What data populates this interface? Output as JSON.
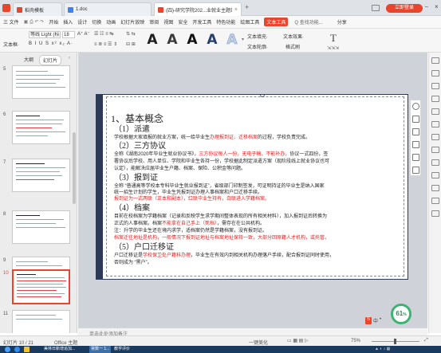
{
  "tabs": [
    {
      "label": "稻壳模板",
      "color": "#e8452c"
    },
    {
      "label": "1.doc",
      "color": "#3b82f6"
    },
    {
      "label": "(四)-研究学院202...业就业主题班会",
      "color": "#e8452c"
    }
  ],
  "login_button": "立即登录",
  "menu": {
    "file": "三 文件",
    "items": [
      "开始",
      "插入",
      "设计",
      "切换",
      "动画",
      "幻灯片放映",
      "审阅",
      "视图",
      "安全",
      "开发工具",
      "特色功能",
      "绘图工具",
      "文本工具"
    ],
    "active": "文本工具",
    "search": "Q 查找功能...",
    "share": "分享"
  },
  "toolbar": {
    "font": "等线 Light (标题)",
    "size": "18",
    "text_box": "文本框·",
    "text_fill": "文本填充·",
    "text_outline": "文本轮廓·",
    "text_effect": "文本效果·",
    "wordart_glyph": "A",
    "wordart_count": 5,
    "styles": [
      "#1f1f1f",
      "#3a3a3a",
      "#111111",
      "#27406b",
      "#bfcde5"
    ],
    "format_painter": "格式刷"
  },
  "left_panel": {
    "header": "大纲",
    "tab": "幻灯片",
    "slide_numbers": [
      "5",
      "6",
      "7",
      "8",
      "9",
      "10",
      "11"
    ],
    "selected": "10"
  },
  "slide": {
    "h1": "1、基本概念",
    "s1": "（1）派遣",
    "p1a": "学校根据大家填报的就业方案，统一给毕业生",
    "p1b": "办理报到证、迁移档案",
    "p1c": "的过程，学校负责完成。",
    "s2": "（2）三方协议",
    "p2a": "全称《湖南2020年毕业生就业协议书》，",
    "p2b": "三方协议每人一份，无电子稿，不能补办。",
    "p2c": "协议一式四份，签",
    "p2d": "署协议后学校、用人单位、学院和毕业生各持一份，学校据此制定派遣方案（现阶段线上就业协议也可",
    "p2e": "认定），能解决应届毕业生户籍、档案、保险、公积金等问题。",
    "s3": "（3）报到证",
    "p3a": "全称 “普通高等学校本专科毕业生就业报到证”，省级部门印制签发，可证明持证的毕业生是纳入国家",
    "p3b": "统一招生计划的学生，毕业生凭报到证办理人事档案和户口迁移手续。",
    "p3c": "报到证为一式两联（正本和副本），红联毕业生持有，白联进入学籍档案。",
    "s4": "（4）档案",
    "p4a": "目前在校档案为学籍档案（记录和反映学生求学期间整体表现的所有相关材料），加入报到证后转换为",
    "p4b": "正式的人事档案。档案",
    "p4c": "不能拿在自己手上（死档）",
    "p4d": "，需存在在公共机构。",
    "p4e": "注：升学的毕业生还在境内求学，适档案仍然是学籍档案，没有报到证。",
    "p4f": "档案迁往地址是机构，一般情况下报到证地址与档案地址保持一致，大部分回原籍人才机构，或托管。",
    "s5": "（5）户口迁移证",
    "p5a": "户口迁移证是",
    "p5b": "学校保卫处户籍科办理",
    "p5c": "，毕业生在有效内到相关机构办理落户手续，配合报到证同时使用，",
    "p5d": "否则成为 “黑户”。"
  },
  "notes_placeholder": "单击此处添加备注",
  "status": {
    "slide_info": "幻灯片 10 / 21",
    "theme": "Office 主题",
    "check": "一键美化",
    "zoom": "75%"
  },
  "speed_widget": {
    "percent": "61",
    "unit": "%"
  },
  "taskbar": {
    "items": [
      "美林日新增追加...",
      "常数一 1...",
      "教学评价"
    ]
  }
}
